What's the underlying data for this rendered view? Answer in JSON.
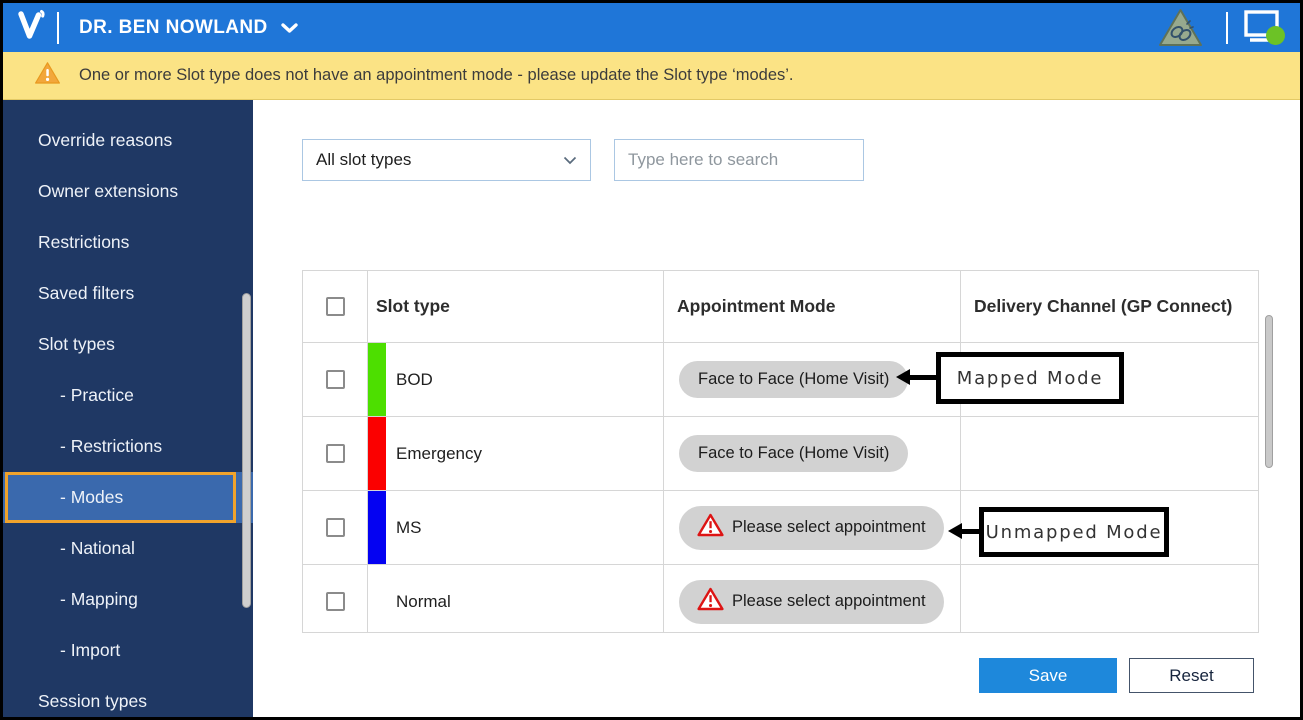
{
  "header": {
    "user_name": "DR. BEN NOWLAND"
  },
  "banner": {
    "text": "One or more Slot type does not have an appointment mode - please update the Slot type ‘modes’."
  },
  "sidebar": {
    "items": [
      {
        "label": "Override reasons",
        "sub": false,
        "selected": false
      },
      {
        "label": "Owner extensions",
        "sub": false,
        "selected": false
      },
      {
        "label": "Restrictions",
        "sub": false,
        "selected": false
      },
      {
        "label": "Saved filters",
        "sub": false,
        "selected": false
      },
      {
        "label": "Slot types",
        "sub": false,
        "selected": false
      },
      {
        "label": "- Practice",
        "sub": true,
        "selected": false
      },
      {
        "label": "- Restrictions",
        "sub": true,
        "selected": false
      },
      {
        "label": "- Modes",
        "sub": true,
        "selected": true
      },
      {
        "label": "- National",
        "sub": true,
        "selected": false
      },
      {
        "label": "- Mapping",
        "sub": true,
        "selected": false
      },
      {
        "label": "- Import",
        "sub": true,
        "selected": false
      },
      {
        "label": "Session types",
        "sub": false,
        "selected": false
      }
    ]
  },
  "filters": {
    "slot_type_filter_value": "All slot types",
    "search_placeholder": "Type here to search"
  },
  "table": {
    "select_all_checked": false,
    "headers": {
      "slot_type": "Slot type",
      "appointment_mode": "Appointment Mode",
      "delivery_channel": "Delivery Channel (GP Connect)"
    },
    "rows": [
      {
        "slot_type": "BOD",
        "color": "#4ddf00",
        "mode_label": "Face to Face (Home Visit)",
        "mode_status": "mapped",
        "delivery_channel": "",
        "checked": false
      },
      {
        "slot_type": "Emergency",
        "color": "#fb0000",
        "mode_label": "Face to Face (Home Visit)",
        "mode_status": "mapped",
        "delivery_channel": "",
        "checked": false
      },
      {
        "slot_type": "MS",
        "color": "#0402f2",
        "mode_label": "Please select appointment",
        "mode_status": "unmapped",
        "delivery_channel": "",
        "checked": false
      },
      {
        "slot_type": "Normal",
        "color": "",
        "mode_label": "Please select appointment",
        "mode_status": "unmapped",
        "delivery_channel": "",
        "checked": false
      }
    ]
  },
  "annotations": {
    "mapped_label": "Mapped Mode",
    "unmapped_label": "Unmapped Mode"
  },
  "actions": {
    "save": "Save",
    "reset": "Reset"
  },
  "icons": {
    "logo": "vision-v-logo",
    "user_chevron": "chevron-down",
    "hazard": "hazard-triangle",
    "status": "monitor-online-green-dot",
    "banner_warning": "orange-warning-triangle",
    "pill_warning": "red-warning-triangle"
  },
  "colors": {
    "topbar": "#1f76d8",
    "sidebar": "#1f3864",
    "sidebar_selected_bg": "#3a69ad",
    "sidebar_selected_border": "#f0a32c",
    "banner_bg": "#fbe385",
    "pill_bg": "#d2d2d2",
    "save_bg": "#1e88db",
    "status_green": "#6cc226"
  }
}
